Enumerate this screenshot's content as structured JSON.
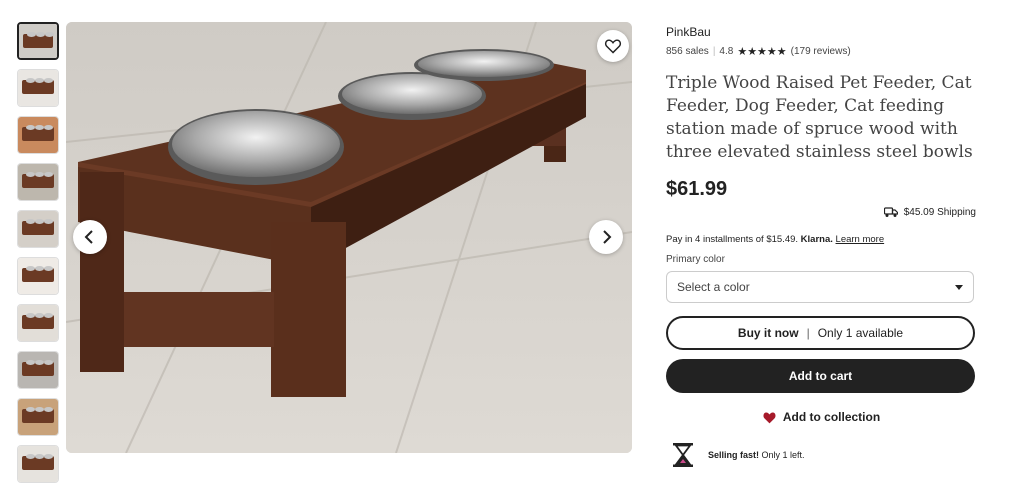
{
  "thumbnails": [
    {
      "bg": "#cfccc7",
      "active": true
    },
    {
      "bg": "#e9e6e2",
      "active": false
    },
    {
      "bg": "#c98a5e",
      "active": false
    },
    {
      "bg": "#bdb7ad",
      "active": false
    },
    {
      "bg": "#d4cfc8",
      "active": false
    },
    {
      "bg": "#efebe6",
      "active": false
    },
    {
      "bg": "#e2ded8",
      "active": false
    },
    {
      "bg": "#b9b6b2",
      "active": false
    },
    {
      "bg": "#c8a27a",
      "active": false
    },
    {
      "bg": "#e6e3de",
      "active": false
    }
  ],
  "product": {
    "shop_name": "PinkBau",
    "sales": "856 sales",
    "rating": "4.8",
    "stars": "★★★★★",
    "reviews": "(179 reviews)",
    "title": "Triple Wood Raised Pet Feeder, Cat Feeder, Dog Feeder, Cat feeding station made of spruce wood with three elevated stainless steel bowls",
    "price": "$61.99",
    "shipping": "$45.09 Shipping",
    "installments_text": "Pay in 4 installments of $15.49.",
    "installments_brand": "Klarna.",
    "learn_more": "Learn more",
    "color_label": "Primary color",
    "color_placeholder": "Select a color",
    "buy_now": "Buy it now",
    "availability": "Only 1 available",
    "add_to_cart": "Add to cart",
    "add_to_collection": "Add to collection",
    "selling_fast_bold": "Selling fast!",
    "selling_fast_rest": "Only 1 left."
  },
  "icons": {
    "favorite": "heart-outline-icon",
    "prev": "chevron-left-icon",
    "next": "chevron-right-icon",
    "shipping": "truck-icon",
    "dropdown": "caret-down-icon",
    "collection": "heart-filled-icon",
    "hourglass": "hourglass-icon"
  },
  "colors": {
    "accent": "#222222",
    "collection_heart": "#a61a2a"
  }
}
